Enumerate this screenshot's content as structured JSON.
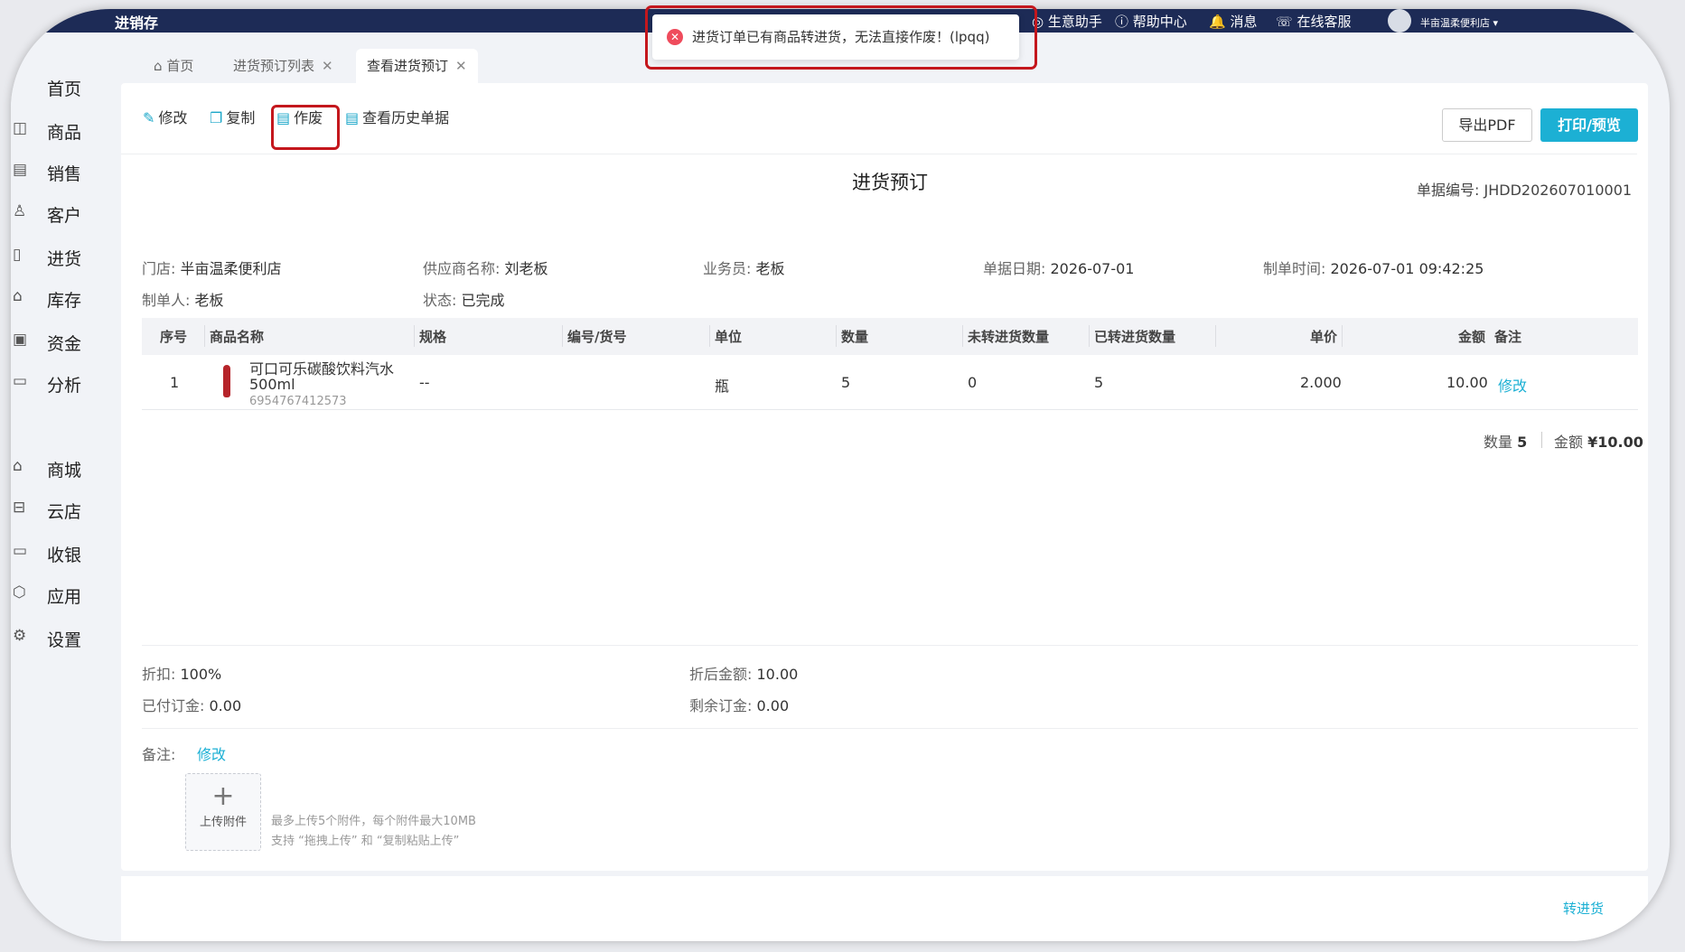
{
  "topbar": {
    "brand": "进销存",
    "links": [
      "生意助手",
      "帮助中心",
      "消息",
      "在线客服"
    ],
    "store": "半亩温柔便利店"
  },
  "sidebar": {
    "items": [
      {
        "label": "首页",
        "icon": "home-icon"
      },
      {
        "label": "商品",
        "icon": "goods-icon"
      },
      {
        "label": "销售",
        "icon": "sales-icon"
      },
      {
        "label": "客户",
        "icon": "customer-icon"
      },
      {
        "label": "进货",
        "icon": "purchase-icon"
      },
      {
        "label": "库存",
        "icon": "stock-icon"
      },
      {
        "label": "资金",
        "icon": "funds-icon"
      },
      {
        "label": "分析",
        "icon": "analysis-icon"
      },
      {
        "label": "商城",
        "icon": "mall-icon"
      },
      {
        "label": "云店",
        "icon": "cloud-store-icon"
      },
      {
        "label": "收银",
        "icon": "cashier-icon"
      },
      {
        "label": "应用",
        "icon": "apps-icon"
      },
      {
        "label": "设置",
        "icon": "settings-icon"
      }
    ]
  },
  "tabs": [
    {
      "label": "首页"
    },
    {
      "label": "进货预订列表"
    },
    {
      "label": "查看进货预订"
    }
  ],
  "toolbar": {
    "edit": "修改",
    "copy": "复制",
    "void": "作废",
    "history": "查看历史单据",
    "export_pdf": "导出PDF",
    "print": "打印/预览"
  },
  "toast": {
    "message": "进货订单已有商品转进货，无法直接作废！(lpqq)"
  },
  "doc": {
    "title": "进货预订",
    "number_label": "单据编号:",
    "number": "JHDD202607010001",
    "fields": {
      "store_k": "门店:",
      "store_v": "半亩温柔便利店",
      "supplier_k": "供应商名称:",
      "supplier_v": "刘老板",
      "salesman_k": "业务员:",
      "salesman_v": "老板",
      "date_k": "单据日期:",
      "date_v": "2026-07-01",
      "created_k": "制单时间:",
      "created_v": "2026-07-01 09:42:25",
      "maker_k": "制单人:",
      "maker_v": "老板",
      "status_k": "状态:",
      "status_v": "已完成"
    }
  },
  "table": {
    "headers": [
      "序号",
      "商品名称",
      "规格",
      "编号/货号",
      "单位",
      "数量",
      "未转进货数量",
      "已转进货数量",
      "单价",
      "金额",
      "备注"
    ],
    "row": {
      "index": "1",
      "name_line1": "可口可乐碳酸饮料汽水",
      "name_line2": "500ml",
      "barcode": "6954767412573",
      "spec": "--",
      "unit": "瓶",
      "qty": "5",
      "untransferred": "0",
      "transferred": "5",
      "price": "2.000",
      "amount": "10.00",
      "action": "修改"
    },
    "summary": {
      "qty_label": "数量",
      "qty": "5",
      "amount_label": "金额",
      "amount": "¥10.00"
    }
  },
  "footer": {
    "discount_k": "折扣:",
    "discount_v": "100%",
    "after_discount_k": "折后金额:",
    "after_discount_v": "10.00",
    "paid_deposit_k": "已付订金:",
    "paid_deposit_v": "0.00",
    "remaining_deposit_k": "剩余订金:",
    "remaining_deposit_v": "0.00",
    "remark_k": "备注:",
    "remark_edit": "修改",
    "upload_label": "上传附件",
    "upload_hint1": "最多上传5个附件，每个附件最大10MB",
    "upload_hint2": "支持 “拖拽上传” 和 “复制粘贴上传”",
    "transfer": "转进货"
  }
}
